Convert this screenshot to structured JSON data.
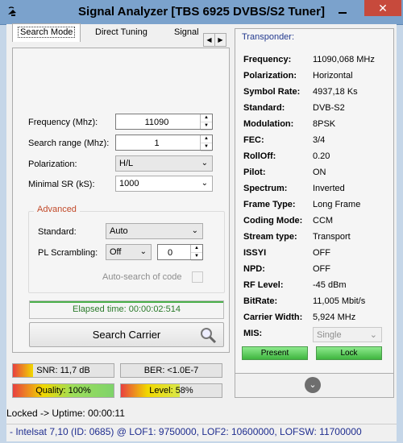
{
  "window": {
    "title": "Signal Analyzer [TBS 6925 DVBS/S2 Tuner]",
    "close_glyph": "✕"
  },
  "tabs": [
    {
      "label": "Search Mode",
      "active": true
    },
    {
      "label": "Direct Tuning",
      "active": false
    },
    {
      "label": "Signal",
      "active": false
    }
  ],
  "search": {
    "frequency_label": "Frequency (Mhz):",
    "frequency_value": "11090",
    "search_range_label": "Search range (Mhz):",
    "search_range_value": "1",
    "polarization_label": "Polarization:",
    "polarization_value": "H/L",
    "minimal_sr_label": "Minimal SR (kS):",
    "minimal_sr_value": "1000",
    "advanced_title": "Advanced",
    "standard_label": "Standard:",
    "standard_value": "Auto",
    "pl_scrambling_label": "PL Scrambling:",
    "pl_scrambling_value": "Off",
    "pl_code_value": "0",
    "auto_search_label": "Auto-search of code",
    "elapsed_text": "Elapsed time: 00:00:02:514",
    "search_button": "Search Carrier"
  },
  "transponder": {
    "title": "Transponder:",
    "rows": [
      {
        "key": "Frequency:",
        "value": "11090,068 MHz"
      },
      {
        "key": "Polarization:",
        "value": "Horizontal"
      },
      {
        "key": "Symbol Rate:",
        "value": "4937,18 Ks"
      },
      {
        "key": "Standard:",
        "value": "DVB-S2"
      },
      {
        "key": "Modulation:",
        "value": "8PSK"
      },
      {
        "key": "FEC:",
        "value": "3/4"
      },
      {
        "key": "RollOff:",
        "value": "0.20"
      },
      {
        "key": "Pilot:",
        "value": "ON"
      },
      {
        "key": "Spectrum:",
        "value": "Inverted"
      },
      {
        "key": "Frame Type:",
        "value": "Long Frame"
      },
      {
        "key": "Coding Mode:",
        "value": "CCM"
      },
      {
        "key": "Stream type:",
        "value": "Transport"
      },
      {
        "key": "ISSYI",
        "value": "OFF"
      },
      {
        "key": "NPD:",
        "value": "OFF"
      },
      {
        "key": "RF Level:",
        "value": "-45 dBm"
      },
      {
        "key": "BitRate:",
        "value": "11,005 Mbit/s"
      },
      {
        "key": "Carrier Width:",
        "value": "5,924 MHz"
      },
      {
        "key": "MIS:",
        "value": ""
      }
    ],
    "mis_value": "Single",
    "present_label": "Present",
    "lock_label": "Lock"
  },
  "meters": {
    "snr": {
      "label": "SNR: 11,7 dB",
      "level": 0.2
    },
    "ber": {
      "label": "BER: <1.0E-7",
      "level": 0.0
    },
    "quality": {
      "label": "Quality: 100%",
      "level": 1.0
    },
    "level": {
      "label": "Level: 58%",
      "level": 0.58
    }
  },
  "status": {
    "locked": "Locked -> Uptime: 00:00:11",
    "satellite_info": "- Intelsat 7,10 (ID: 0685) @ LOF1: 9750000, LOF2: 10600000, LOFSW: 11700000"
  },
  "colors": {
    "accent_blue": "#233a8f",
    "green": "#3fb53f",
    "advanced_title": "#c24a2a"
  }
}
